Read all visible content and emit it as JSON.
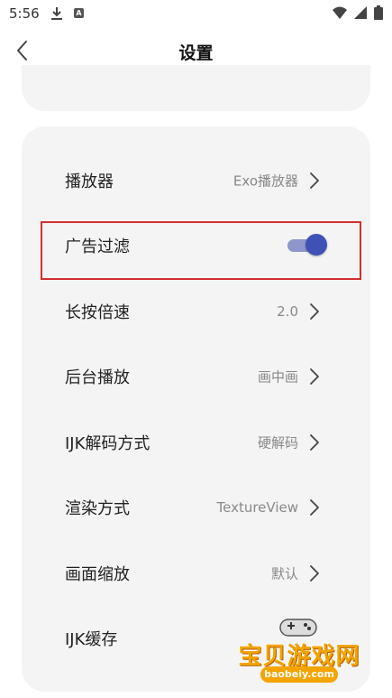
{
  "status_bar": {
    "time": "5:56",
    "icons": [
      "download-icon",
      "a-notification-icon",
      "wifi-icon",
      "signal-icon",
      "battery-icon"
    ]
  },
  "header": {
    "title": "设置",
    "back_icon": "chevron-left-icon"
  },
  "settings": {
    "player": {
      "label": "播放器",
      "value": "Exo播放器"
    },
    "ad_filter": {
      "label": "广告过滤",
      "enabled": true
    },
    "long_press_speed": {
      "label": "长按倍速",
      "value": "2.0"
    },
    "background_play": {
      "label": "后台播放",
      "value": "画中画"
    },
    "ijk_decode": {
      "label": "IJK解码方式",
      "value": "硬解码"
    },
    "render_mode": {
      "label": "渲染方式",
      "value": "TextureView"
    },
    "scale": {
      "label": "画面缩放",
      "value": "默认"
    },
    "ijk_cache": {
      "label": "IJK缓存"
    }
  },
  "watermark": {
    "text": "宝贝游戏网",
    "url": "baobeiy.com"
  },
  "colors": {
    "card_bg": "#f4f4f4",
    "toggle_thumb": "#3f51b5",
    "toggle_track": "#8f96cc",
    "highlight_border": "#d32f2f",
    "watermark": "#f4a400"
  }
}
